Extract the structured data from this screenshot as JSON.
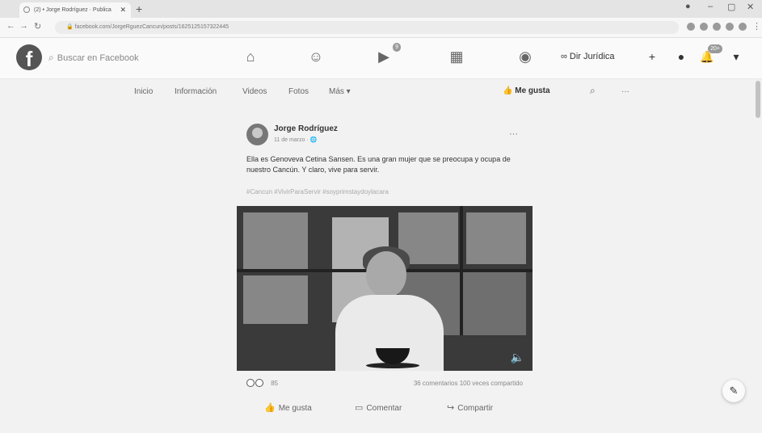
{
  "browser": {
    "tab_title": "(2) • Jorge Rodríguez · Publica",
    "tab_close": "✕",
    "new_tab": "+",
    "url": "facebook.com/JorgeRguezCancun/posts/1625125157322445",
    "window_controls": [
      "–",
      "▢",
      "✕"
    ]
  },
  "facebook": {
    "logo": "f",
    "search_placeholder": "Buscar en Facebook",
    "notifications_badge": "20+",
    "video_badge": "9",
    "page_name": "Dir Jurídica",
    "plus": "+"
  },
  "page_tabs": {
    "items": [
      "Inicio",
      "Información",
      "Videos",
      "Fotos",
      "Más ▾"
    ],
    "like_button": "Me gusta",
    "more": "···"
  },
  "post": {
    "author": "Jorge Rodríguez",
    "date": "11 de marzo · 🌐",
    "more": "···",
    "text": "Ella es Genoveva Cetina Sansen. Es una gran mujer que se preocupa y ocupa de nuestro Cancún. Y claro, vive para servir.",
    "hashtags": "#Cancun #VivirParaServir #soyprimstaydoylacara",
    "reactions_count": "85",
    "stats": "36 comentarios  100 veces compartido",
    "actions": {
      "like": "Me gusta",
      "comment": "Comentar",
      "share": "Compartir"
    }
  }
}
